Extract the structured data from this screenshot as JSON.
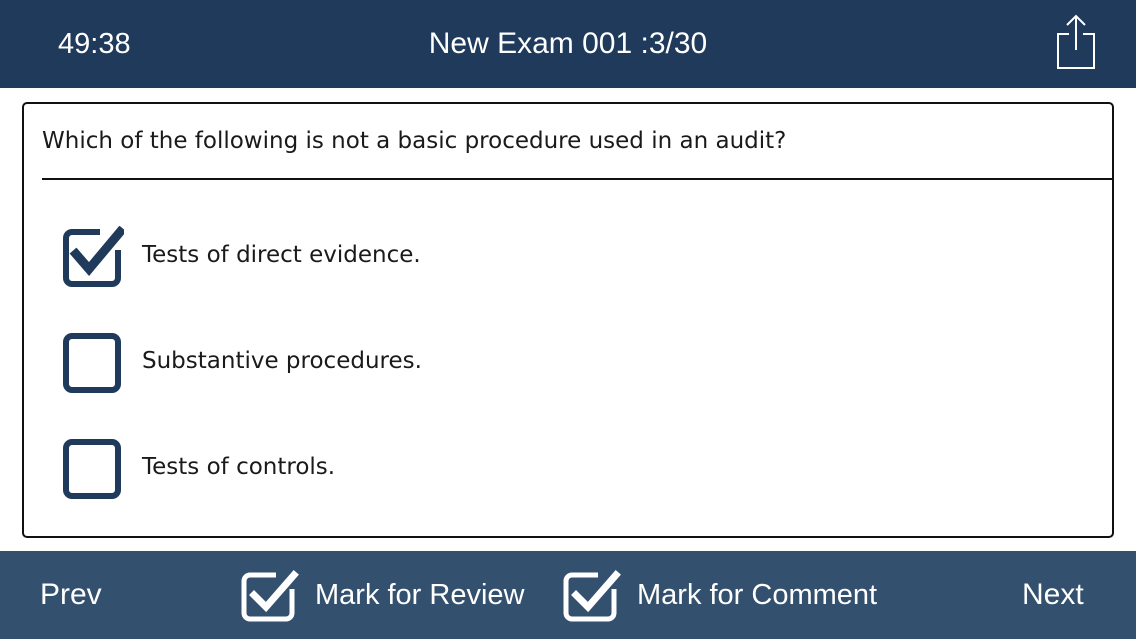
{
  "header": {
    "timer": "49:38",
    "title": "New Exam 001 :3/30",
    "share_icon": "share-icon"
  },
  "question": {
    "text": "Which of the following is not a basic procedure used in an audit?",
    "options": [
      {
        "label": "Tests of direct evidence.",
        "checked": true
      },
      {
        "label": "Substantive procedures.",
        "checked": false
      },
      {
        "label": "Tests of controls.",
        "checked": false
      }
    ]
  },
  "footer": {
    "prev_label": "Prev",
    "mark_review_label": "Mark for Review",
    "mark_comment_label": "Mark for Comment",
    "next_label": "Next"
  },
  "colors": {
    "header_bg": "#1f3a5a",
    "footer_bg": "#33506e",
    "checkbox": "#1f3a5a"
  }
}
